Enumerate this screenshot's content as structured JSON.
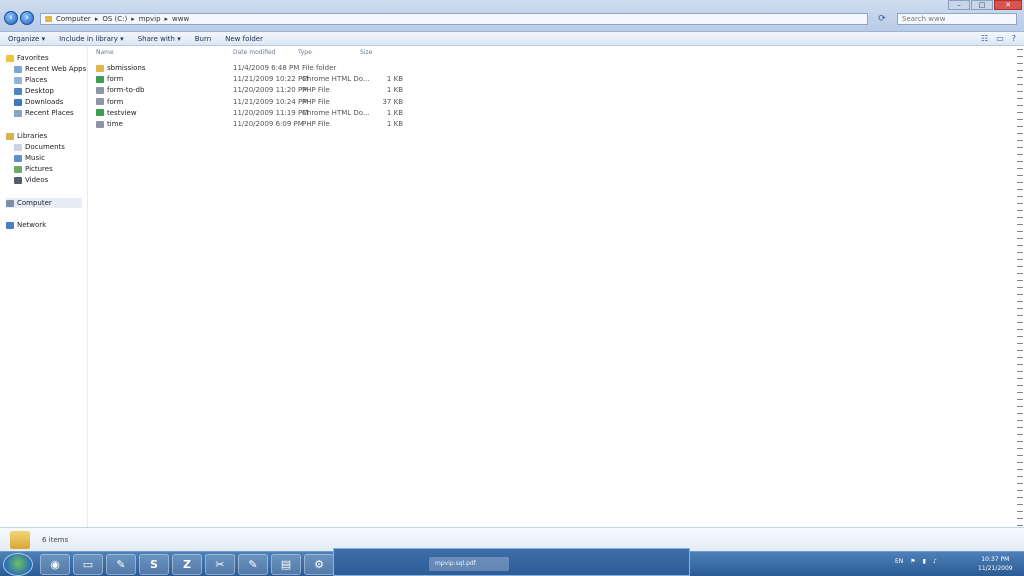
{
  "window": {
    "address_parts": [
      "Computer",
      "▸",
      "OS (C:)",
      "▸",
      "mpvip",
      "▸",
      "www"
    ],
    "search_placeholder": "Search www",
    "controls": [
      "–",
      "□",
      "✕"
    ]
  },
  "toolbar": {
    "organize": "Organize ▾",
    "include": "Include in library ▾",
    "share": "Share with ▾",
    "burn": "Burn",
    "new_folder": "New folder"
  },
  "nav": {
    "favorites": "Favorites",
    "recent_sites": "Recent Web Apps",
    "places": "Places",
    "desktop": "Desktop",
    "downloads": "Downloads",
    "recent_places": "Recent Places",
    "libraries": "Libraries",
    "documents": "Documents",
    "music": "Music",
    "pictures": "Pictures",
    "videos": "Videos",
    "computer": "Computer",
    "network": "Network"
  },
  "columns": {
    "name": "Name",
    "date": "Date modified",
    "type": "Type",
    "size": "Size"
  },
  "files": [
    {
      "name": "sbmissions",
      "date": "11/4/2009 6:48 PM",
      "type": "File folder",
      "size": "",
      "icon": "folder-icon"
    },
    {
      "name": "form",
      "date": "11/21/2009 10:22 PM",
      "type": "Chrome HTML Do...",
      "size": "1 KB",
      "icon": "chrome-icon"
    },
    {
      "name": "form-to-db",
      "date": "11/20/2009 11:20 PM",
      "type": "PHP File",
      "size": "1 KB",
      "icon": "php-file-icon"
    },
    {
      "name": "form",
      "date": "11/21/2009 10:24 PM",
      "type": "PHP File",
      "size": "37 KB",
      "icon": "php-file-icon"
    },
    {
      "name": "testview",
      "date": "11/20/2009 11:19 PM",
      "type": "Chrome HTML Do...",
      "size": "1 KB",
      "icon": "chrome-icon"
    },
    {
      "name": "time",
      "date": "11/20/2009 6:09 PM",
      "type": "PHP File",
      "size": "1 KB",
      "icon": "php-file-icon"
    }
  ],
  "status": {
    "text": "6 items"
  },
  "taskbar": {
    "apps": [
      {
        "label": "◉",
        "name": "chrome-icon"
      },
      {
        "label": "▭",
        "name": "folder-icon"
      },
      {
        "label": "✎",
        "name": "paint-icon"
      },
      {
        "label": "S",
        "name": "skype-icon"
      },
      {
        "label": "Z",
        "name": "filezilla-icon"
      },
      {
        "label": "✂",
        "name": "tools-icon"
      },
      {
        "label": "✎",
        "name": "notepad-icon"
      },
      {
        "label": "▤",
        "name": "explorer-icon"
      },
      {
        "label": "⚙",
        "name": "settings-icon"
      },
      {
        "label": "▣",
        "name": "image-viewer-icon"
      }
    ],
    "popup_item": "mpvip.sql.pdf",
    "lang": "EN",
    "time": "10:37 PM",
    "date": "11/21/2009"
  }
}
